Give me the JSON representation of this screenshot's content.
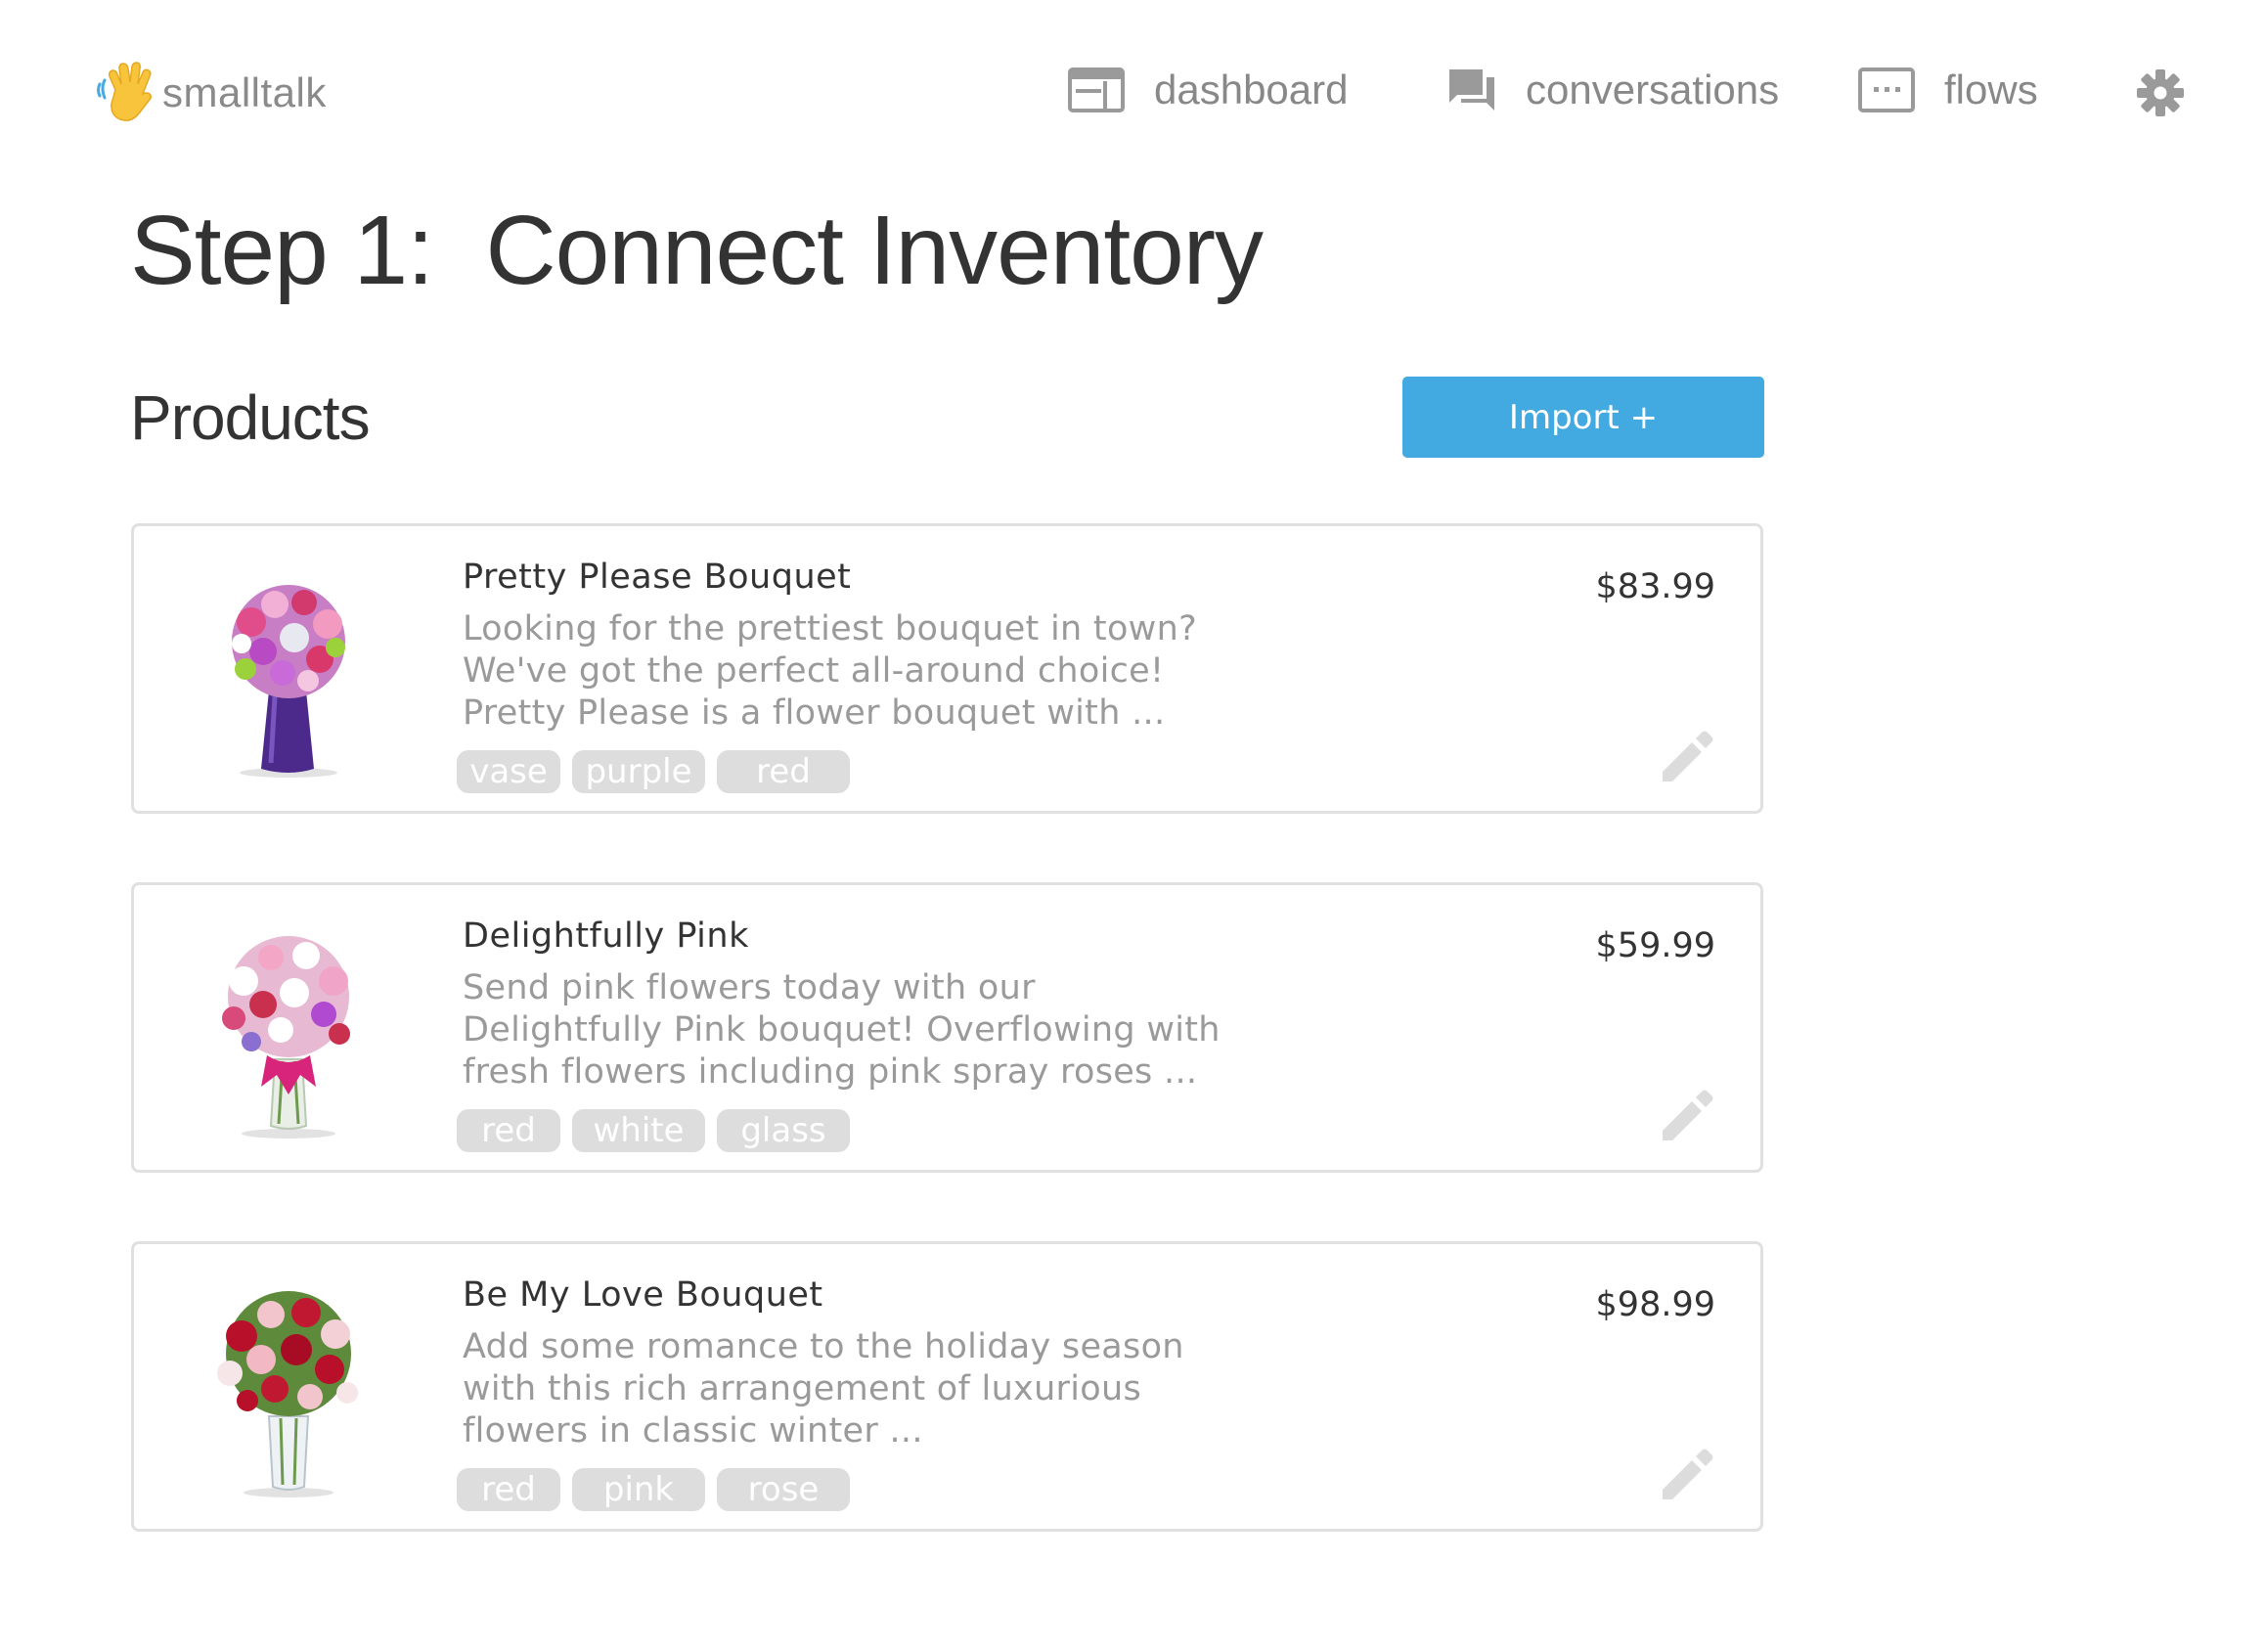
{
  "app": {
    "name": "smalltalk"
  },
  "nav": {
    "items": [
      {
        "label": "dashboard",
        "icon": "dashboard-icon"
      },
      {
        "label": "conversations",
        "icon": "conversations-icon"
      },
      {
        "label": "flows",
        "icon": "flows-icon"
      }
    ],
    "settings_icon": "gear-icon"
  },
  "page": {
    "title": "Step 1:  Connect Inventory",
    "section_title": "Products",
    "import_label": "Import +"
  },
  "products": [
    {
      "name": "Pretty Please Bouquet",
      "description": [
        "Looking for the prettiest bouquet in town?",
        "We've got the perfect all-around choice!",
        "Pretty Please is a flower bouquet with ..."
      ],
      "price": "$83.99",
      "tags": [
        "vase",
        "purple",
        "red"
      ]
    },
    {
      "name": "Delightfully Pink",
      "description": [
        "Send pink flowers today with our",
        "Delightfully Pink bouquet! Overflowing with",
        "fresh flowers including pink spray roses ..."
      ],
      "price": "$59.99",
      "tags": [
        "red",
        "white",
        "glass"
      ]
    },
    {
      "name": "Be My Love Bouquet",
      "description": [
        "Add some romance to the holiday season",
        "with this rich arrangement of luxurious",
        "flowers in classic winter ..."
      ],
      "price": "$98.99",
      "tags": [
        "red",
        "pink",
        "rose"
      ]
    }
  ],
  "colors": {
    "accent": "#42a9e1",
    "tag_background": "#dddddd",
    "nav_text": "#888888",
    "description_text": "#9a9a9a",
    "logo_hand": "#f7c43b"
  }
}
